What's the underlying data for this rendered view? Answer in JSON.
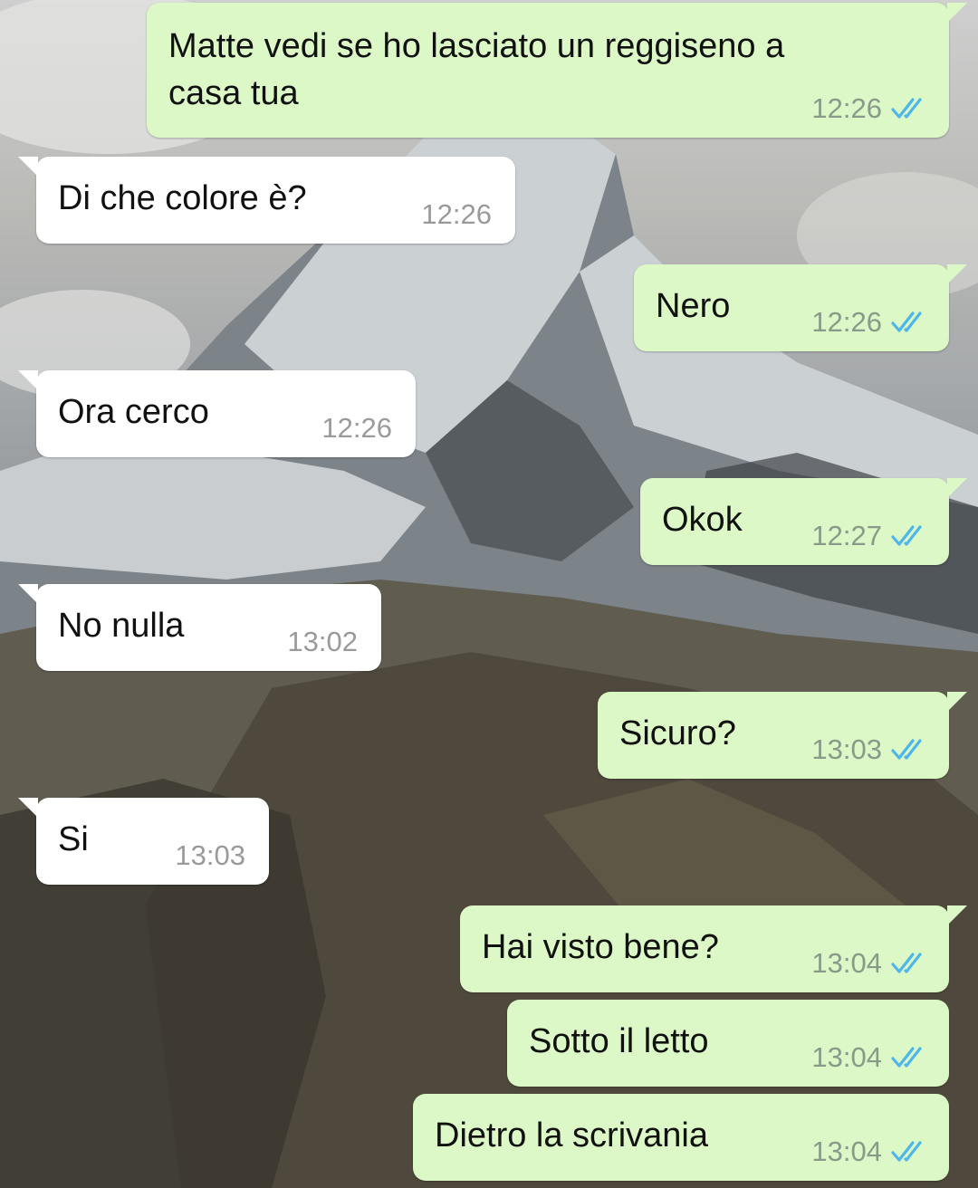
{
  "chat": {
    "messages": [
      {
        "direction": "out",
        "text": "Matte vedi se ho lasciato un reggiseno a\ncasa tua",
        "time": "12:26",
        "status_icon": "double-check-icon",
        "status_color": "#4fb6ec"
      },
      {
        "direction": "in",
        "text": "Di che colore è?",
        "time": "12:26"
      },
      {
        "direction": "out",
        "text": "Nero",
        "time": "12:26",
        "status_icon": "double-check-icon",
        "status_color": "#4fb6ec"
      },
      {
        "direction": "in",
        "text": "Ora cerco",
        "time": "12:26"
      },
      {
        "direction": "out",
        "text": "Okok",
        "time": "12:27",
        "status_icon": "double-check-icon",
        "status_color": "#4fb6ec"
      },
      {
        "direction": "in",
        "text": "No nulla",
        "time": "13:02"
      },
      {
        "direction": "out",
        "text": "Sicuro?",
        "time": "13:03",
        "status_icon": "double-check-icon",
        "status_color": "#4fb6ec"
      },
      {
        "direction": "in",
        "text": "Si",
        "time": "13:03"
      },
      {
        "direction": "out",
        "text": "Hai visto bene?",
        "time": "13:04",
        "status_icon": "double-check-icon",
        "status_color": "#4fb6ec"
      },
      {
        "direction": "out",
        "text": "Sotto il letto",
        "time": "13:04",
        "status_icon": "double-check-icon",
        "status_color": "#4fb6ec"
      },
      {
        "direction": "out",
        "text": "Dietro la scrivania",
        "time": "13:04",
        "status_icon": "double-check-icon",
        "status_color": "#4fb6ec"
      }
    ]
  },
  "theme": {
    "outgoing_bubble": "#dcf8c6",
    "incoming_bubble": "#ffffff",
    "wallpaper": "mountain-wallpaper"
  }
}
